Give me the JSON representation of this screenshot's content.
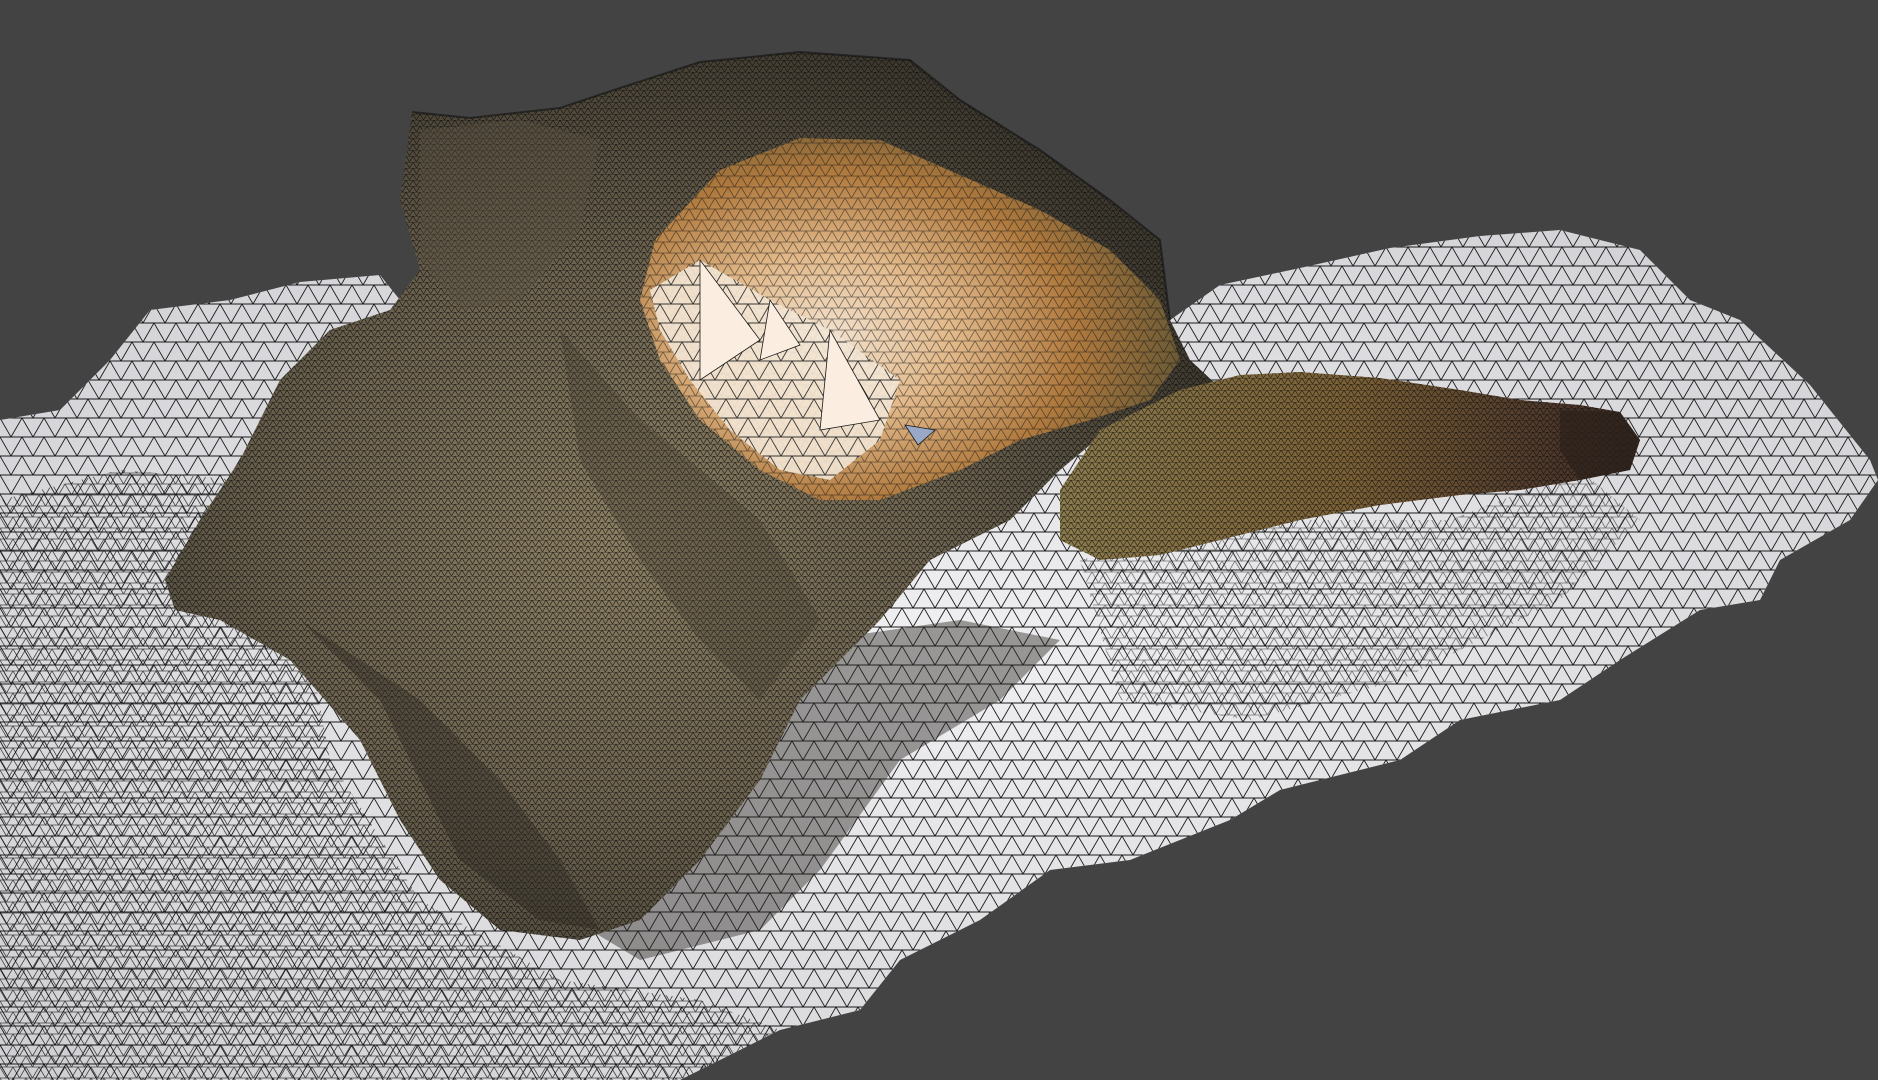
{
  "viewport": {
    "background_color": "#434343",
    "shading": "textured-wireframe"
  },
  "scene": {
    "object": "photogrammetry-rock-mesh",
    "colors": {
      "ground_mesh_fill": "#e6e6e8",
      "wire": "#1a1a1a",
      "rock_dark": "#4a4538",
      "rock_mid": "#6e6450",
      "rock_light": "#8c7f62",
      "cavity_orange": "#a8743a",
      "cavity_light": "#efd9bd",
      "arm_brown": "#6a5634",
      "arm_dark": "#3a2c22"
    }
  }
}
